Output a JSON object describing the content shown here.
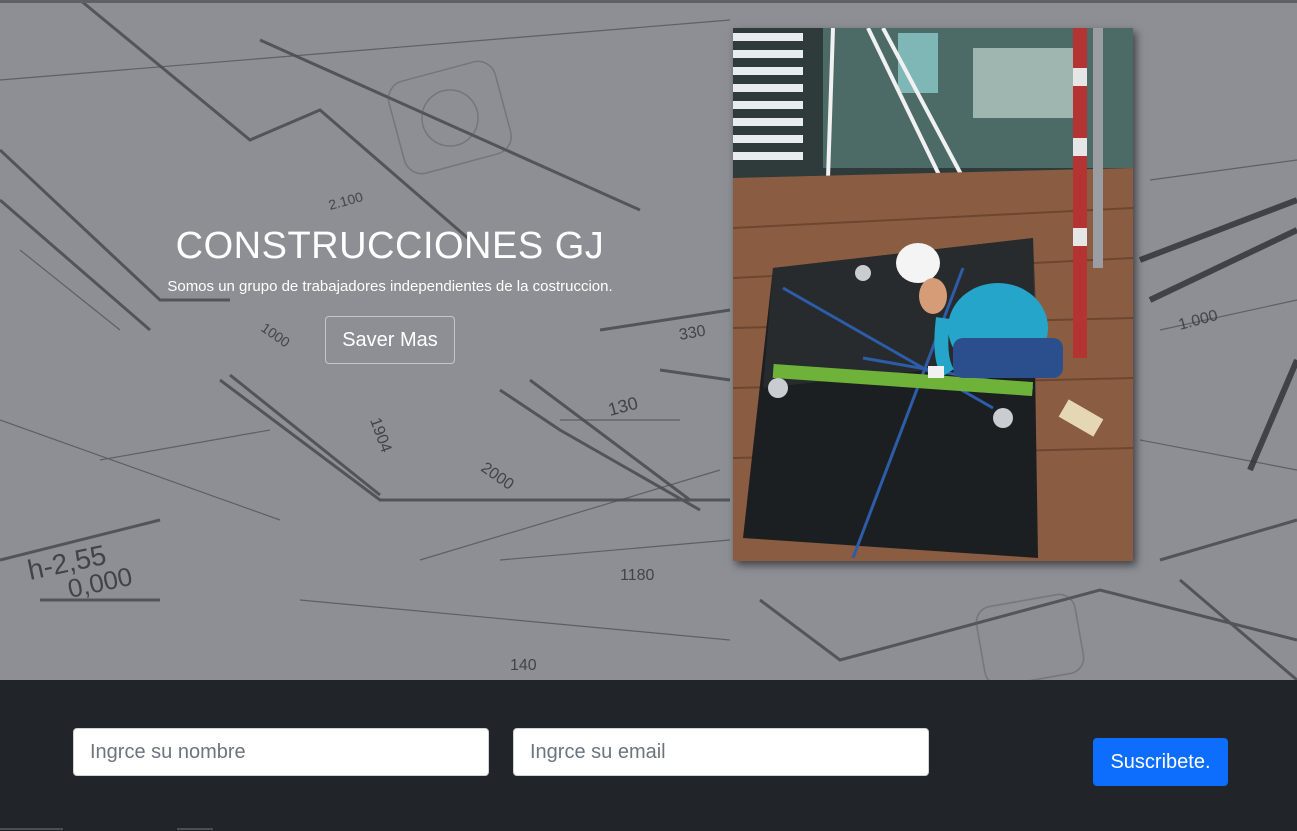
{
  "hero": {
    "title": "CONSTRUCCIONES GJ",
    "subtitle": "Somos un grupo de trabajadores independientes de la costruccion.",
    "button_label": "Saver Mas",
    "photo_icon": "construction-worker-glass-photo"
  },
  "subscribe_form": {
    "name_placeholder": "Ingrce su nombre",
    "email_placeholder": "Ingrce su email",
    "submit_label": "Suscribete."
  },
  "colors": {
    "hero_overlay": "#8d8f95",
    "footer_bg": "#212429",
    "primary_button": "#0d6efd",
    "text_light": "#ffffff"
  }
}
